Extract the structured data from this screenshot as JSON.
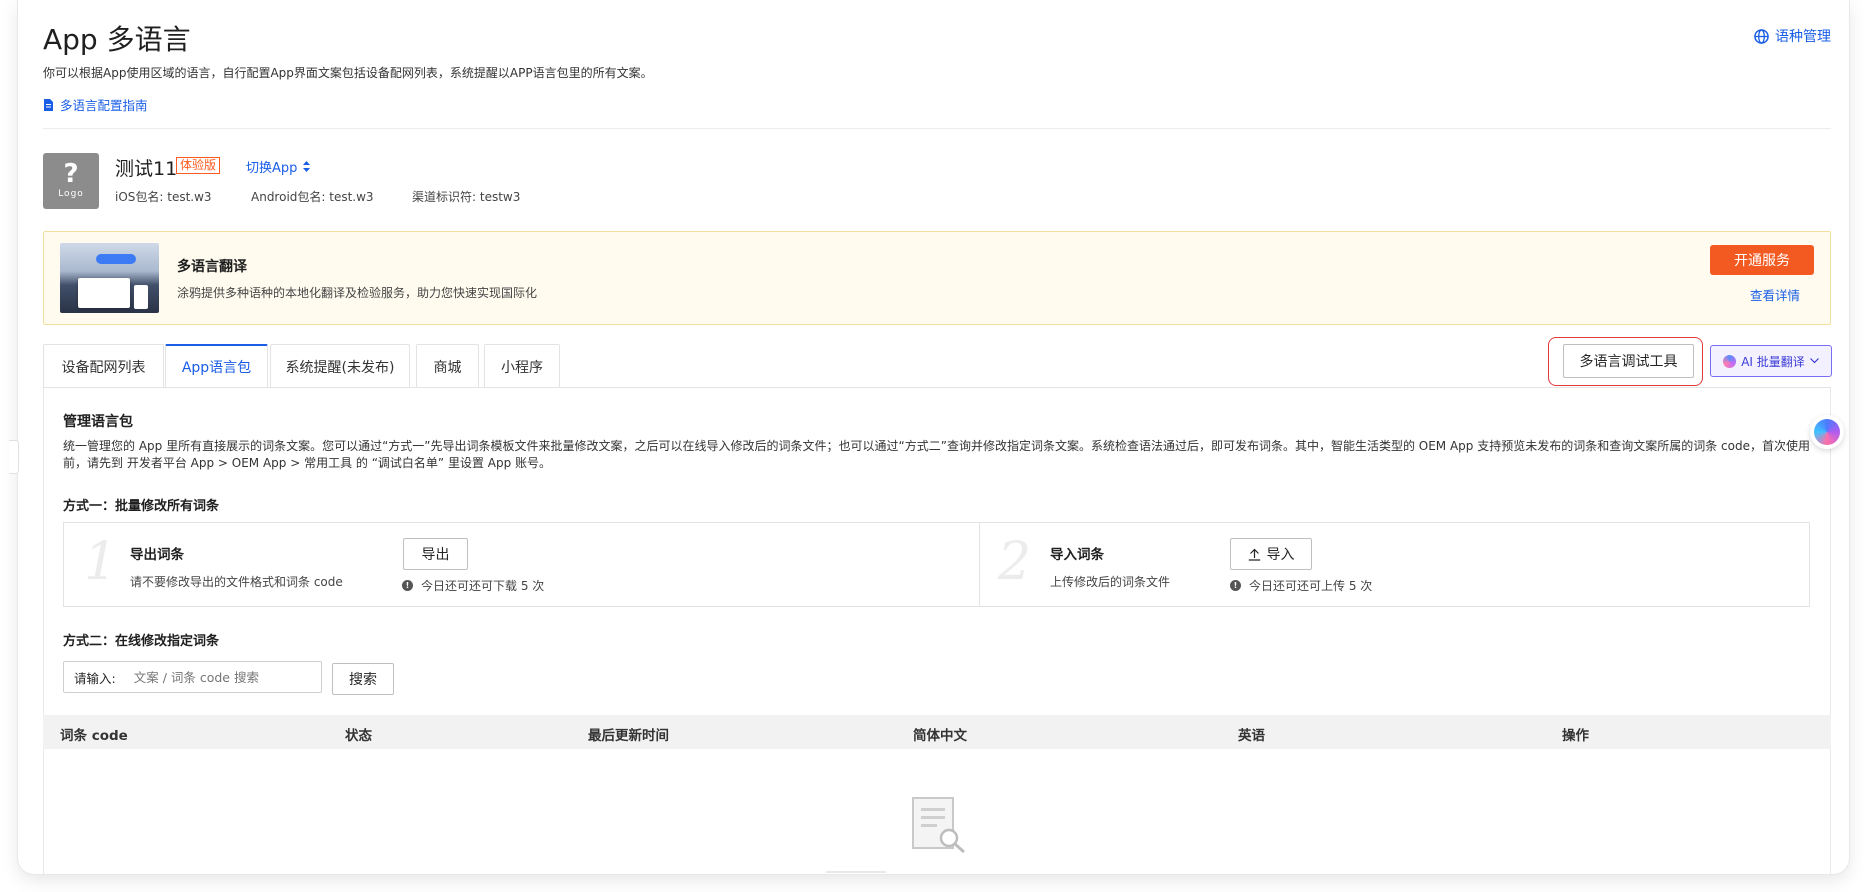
{
  "header": {
    "title": "App 多语言",
    "description": "你可以根据App使用区域的语言，自行配置App界面文案包括设备配网列表，系统提醒以APP语言包里的所有文案。",
    "guide_link": "多语言配置指南",
    "lang_manage": "语种管理"
  },
  "app": {
    "logo_mark": "?",
    "logo_text": "Logo",
    "name": "测试11",
    "badge": "体验版",
    "switch_label": "切换App",
    "ios_pkg": "iOS包名: test.w3",
    "android_pkg": "Android包名: test.w3",
    "channel": "渠道标识符: testw3"
  },
  "banner": {
    "title": "多语言翻译",
    "subtitle": "涂鸦提供多种语种的本地化翻译及检验服务，助力您快速实现国际化",
    "open_button": "开通服务",
    "detail_link": "查看详情"
  },
  "tabs": [
    {
      "label": "设备配网列表",
      "active": false
    },
    {
      "label": "App语言包",
      "active": true
    },
    {
      "label": "系统提醒(未发布)",
      "active": false
    },
    {
      "label": "商城",
      "active": false
    },
    {
      "label": "小程序",
      "active": false
    }
  ],
  "toolbar": {
    "debug_tool": "多语言调试工具",
    "ai_translate": "AI 批量翻译"
  },
  "manage": {
    "title": "管理语言包",
    "description": "统一管理您的 App 里所有直接展示的词条文案。您可以通过“方式一”先导出词条模板文件来批量修改文案，之后可以在线导入修改后的词条文件；也可以通过“方式二”查询并修改指定词条文案。系统检查语法通过后，即可发布词条。其中，智能生活类型的 OEM App 支持预览未发布的词条和查询文案所属的词条 code，首次使用前，请先到 开发者平台 App > OEM App > 常用工具 的 “调试白名单” 里设置 App 账号。"
  },
  "way1": {
    "title": "方式一：批量修改所有词条",
    "export": {
      "num": "1",
      "title": "导出词条",
      "sub": "请不要修改导出的文件格式和词条 code",
      "button": "导出",
      "hint": "今日还可还可下载 5 次"
    },
    "import": {
      "num": "2",
      "title": "导入词条",
      "sub": "上传修改后的词条文件",
      "button": "导入",
      "hint": "今日还可还可上传 5 次"
    }
  },
  "way2": {
    "title": "方式二：在线修改指定词条",
    "search_label": "请输入:",
    "search_placeholder": "文案 / 词条 code 搜索",
    "search_button": "搜索"
  },
  "table": {
    "columns": [
      "词条 code",
      "状态",
      "最后更新时间",
      "简体中文",
      "英语",
      "操作"
    ],
    "rows": []
  },
  "colors": {
    "accent": "#1a5ee6",
    "brand_orange": "#f25a21",
    "banner_bg": "#fffcef",
    "highlight_outline": "#e23b3b"
  },
  "icons": [
    "document-icon",
    "globe-icon",
    "sort-arrows-icon",
    "upload-icon",
    "info-icon",
    "chevron-down-icon",
    "ai-sparkle-icon",
    "empty-search-icon"
  ]
}
